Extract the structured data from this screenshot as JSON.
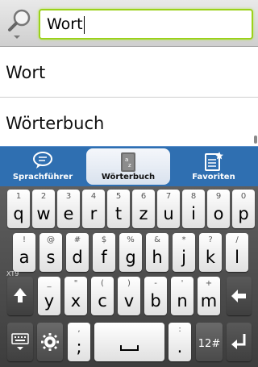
{
  "search": {
    "value": "Wort"
  },
  "results": [
    "Wort",
    "Wörterbuch"
  ],
  "tabs": [
    {
      "label": "Sprachführer",
      "icon": "speech-bubble-icon",
      "active": false
    },
    {
      "label": "Wörterbuch",
      "icon": "dictionary-book-icon",
      "active": true
    },
    {
      "label": "Favoriten",
      "icon": "favorites-list-icon",
      "active": false
    }
  ],
  "keyboard": {
    "row1": [
      {
        "main": "q",
        "alt": "1"
      },
      {
        "main": "w",
        "alt": "2"
      },
      {
        "main": "e",
        "alt": "3"
      },
      {
        "main": "r",
        "alt": "4"
      },
      {
        "main": "t",
        "alt": "5"
      },
      {
        "main": "z",
        "alt": "6"
      },
      {
        "main": "u",
        "alt": "7"
      },
      {
        "main": "i",
        "alt": "8"
      },
      {
        "main": "o",
        "alt": "9"
      },
      {
        "main": "p",
        "alt": "0"
      }
    ],
    "row2": [
      {
        "main": "a",
        "alt": "!"
      },
      {
        "main": "s",
        "alt": "@"
      },
      {
        "main": "d",
        "alt": "#"
      },
      {
        "main": "f",
        "alt": "$"
      },
      {
        "main": "g",
        "alt": "%"
      },
      {
        "main": "h",
        "alt": "&"
      },
      {
        "main": "j",
        "alt": "*"
      },
      {
        "main": "k",
        "alt": "?"
      },
      {
        "main": "l",
        "alt": "/"
      }
    ],
    "row3": [
      {
        "main": "y",
        "alt": "_"
      },
      {
        "main": "x",
        "alt": "\""
      },
      {
        "main": "c",
        "alt": "("
      },
      {
        "main": "v",
        "alt": ")"
      },
      {
        "main": "b",
        "alt": "-"
      },
      {
        "main": "n",
        "alt": "'"
      },
      {
        "main": "m",
        "alt": "+"
      }
    ],
    "xt9_label": "XT9",
    "comma_alt": ",",
    "comma_main": ";",
    "period_alt": ":",
    "period_main": ".",
    "mode_label": "12#"
  }
}
